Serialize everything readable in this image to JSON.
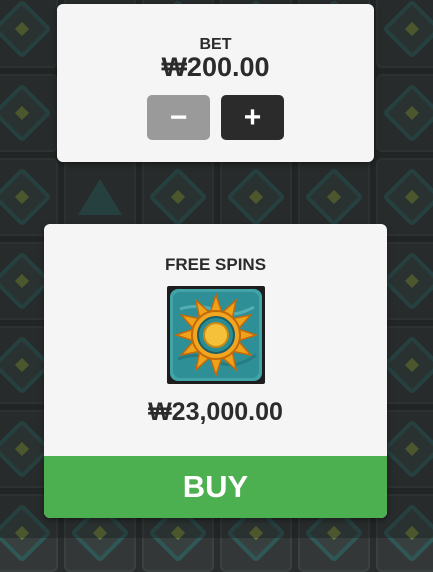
{
  "bet": {
    "label": "BET",
    "amount": "₩200.00",
    "minus_label": "−",
    "plus_label": "+"
  },
  "free_spins": {
    "title": "FREE SPINS",
    "icon": "sun-icon",
    "price": "₩23,000.00",
    "buy_label": "BUY"
  },
  "colors": {
    "buy_button": "#4caf50",
    "plus_button": "#2b2b2b",
    "minus_button": "#9a9a9a",
    "card_bg": "#f5f5f5"
  }
}
